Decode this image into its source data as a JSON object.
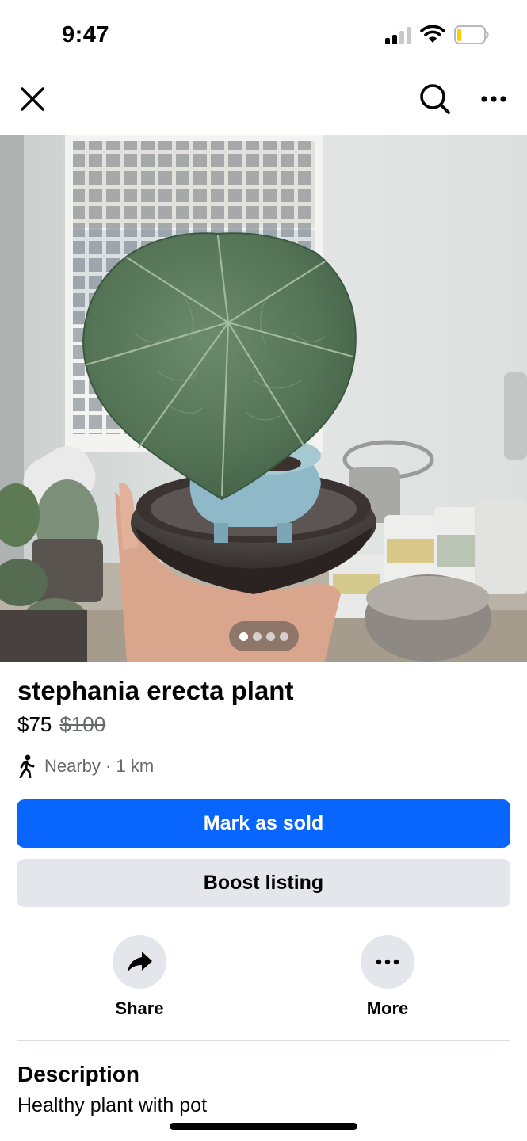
{
  "status_bar": {
    "time": "9:47",
    "signal_icon": "cellular-signal-icon",
    "wifi_icon": "wifi-icon",
    "battery_icon": "battery-low-icon"
  },
  "nav": {
    "close_icon": "close-icon",
    "search_icon": "search-icon",
    "more_icon": "more-horizontal-icon"
  },
  "photo": {
    "subject": "stephania erecta plant",
    "photo_count": 4,
    "current_photo": 1
  },
  "listing": {
    "title": "stephania erecta plant",
    "price": "$75",
    "original_price": "$100",
    "distance": "Nearby · 1 km",
    "distance_icon": "walking-person-icon"
  },
  "buttons": {
    "mark_sold": "Mark as sold",
    "boost": "Boost listing"
  },
  "actions": {
    "share_label": "Share",
    "share_icon": "share-arrow-icon",
    "more_label": "More",
    "more_icon": "more-horizontal-icon"
  },
  "description": {
    "heading": "Description",
    "text": "Healthy plant with pot"
  },
  "colors": {
    "primary": "#0866ff",
    "secondary_button": "#e4e6eb",
    "text_primary": "#050505",
    "text_secondary": "#65676b"
  }
}
